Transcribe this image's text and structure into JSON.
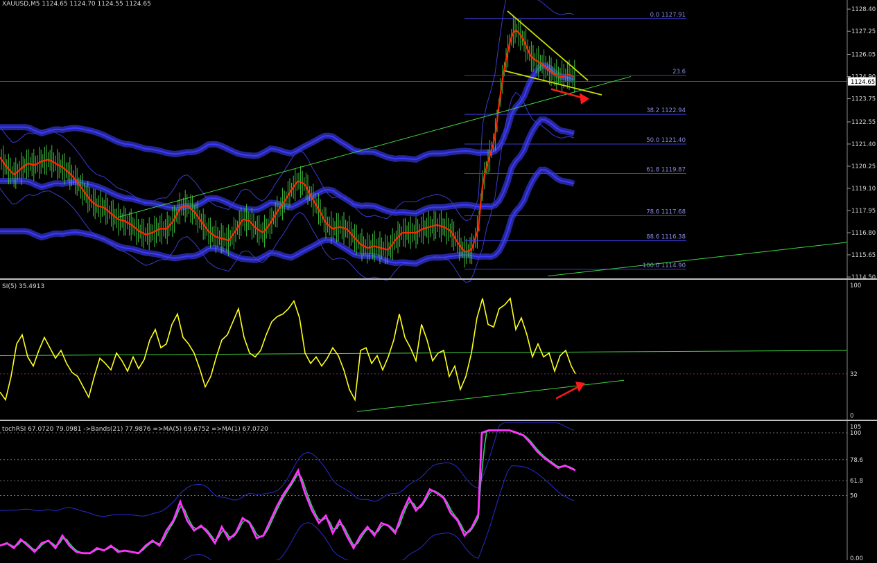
{
  "colors": {
    "background": "#000000",
    "axis_text": "#d8d8d8",
    "separator": "#c0c0c0",
    "bull_bar": "#3fbf3f",
    "price_ma": "#ff2a00",
    "bollinger": "#2a2aa8",
    "bollinger_thin": "#3a3ad0",
    "fib": "#3a3ad8",
    "fib_text": "#8a8ae6",
    "trendline": "#3fd43f",
    "wedge": "#c8e000",
    "rsi": "#ffff1a",
    "stoch": "#ff33ff",
    "stoch_ma": "#22d066",
    "level_dots": "#707070",
    "arrow": "#ff1a1a"
  },
  "chart_data": [
    {
      "type": "candlestick-bars",
      "title": "XAUUSD,M5 1124.65 1124.70 1124.55 1124.65",
      "symbol": "XAUUSD,M5",
      "ohlc_header": [
        "1124.65",
        "1124.70",
        "1124.55",
        "1124.65"
      ],
      "current_price": "1124.65",
      "ylim": [
        1114.5,
        1128.8
      ],
      "y_ticks": [
        "1128.40",
        "1127.25",
        "1126.05",
        "1124.90",
        "1123.75",
        "1122.55",
        "1121.40",
        "1120.25",
        "1119.10",
        "1117.95",
        "1116.80",
        "1115.65",
        "1114.50"
      ],
      "price_path": [
        [
          0,
          1120.7
        ],
        [
          10,
          1120.2
        ],
        [
          20,
          1119.8
        ],
        [
          30,
          1120.1
        ],
        [
          40,
          1120.4
        ],
        [
          50,
          1120.3
        ],
        [
          60,
          1120.5
        ],
        [
          70,
          1120.6
        ],
        [
          80,
          1120.4
        ],
        [
          90,
          1120.2
        ],
        [
          100,
          1119.9
        ],
        [
          110,
          1119.5
        ],
        [
          120,
          1119.0
        ],
        [
          130,
          1118.5
        ],
        [
          140,
          1118.2
        ],
        [
          150,
          1118.1
        ],
        [
          160,
          1117.8
        ],
        [
          170,
          1117.5
        ],
        [
          180,
          1117.4
        ],
        [
          190,
          1117.2
        ],
        [
          200,
          1116.9
        ],
        [
          210,
          1116.7
        ],
        [
          220,
          1116.8
        ],
        [
          230,
          1117.0
        ],
        [
          240,
          1117.0
        ],
        [
          250,
          1117.4
        ],
        [
          260,
          1118.1
        ],
        [
          270,
          1118.2
        ],
        [
          280,
          1117.9
        ],
        [
          290,
          1117.4
        ],
        [
          300,
          1116.9
        ],
        [
          310,
          1116.6
        ],
        [
          320,
          1116.5
        ],
        [
          330,
          1116.4
        ],
        [
          340,
          1116.9
        ],
        [
          350,
          1117.5
        ],
        [
          360,
          1117.4
        ],
        [
          370,
          1117.0
        ],
        [
          380,
          1116.8
        ],
        [
          390,
          1117.3
        ],
        [
          400,
          1117.9
        ],
        [
          410,
          1118.4
        ],
        [
          420,
          1119.0
        ],
        [
          430,
          1119.5
        ],
        [
          440,
          1119.3
        ],
        [
          450,
          1118.6
        ],
        [
          460,
          1118.0
        ],
        [
          470,
          1117.3
        ],
        [
          480,
          1117.0
        ],
        [
          490,
          1117.1
        ],
        [
          500,
          1117.0
        ],
        [
          510,
          1116.6
        ],
        [
          520,
          1116.2
        ],
        [
          530,
          1116.0
        ],
        [
          540,
          1116.1
        ],
        [
          550,
          1116.0
        ],
        [
          560,
          1115.9
        ],
        [
          570,
          1116.4
        ],
        [
          580,
          1116.8
        ],
        [
          590,
          1116.8
        ],
        [
          600,
          1116.8
        ],
        [
          610,
          1117.0
        ],
        [
          620,
          1117.1
        ],
        [
          630,
          1117.2
        ],
        [
          640,
          1117.1
        ],
        [
          650,
          1116.9
        ],
        [
          660,
          1116.3
        ],
        [
          670,
          1115.8
        ],
        [
          680,
          1115.9
        ],
        [
          690,
          1117.0
        ],
        [
          695,
          1119.0
        ],
        [
          700,
          1120.0
        ],
        [
          710,
          1121.2
        ],
        [
          715,
          1122.0
        ],
        [
          720,
          1123.5
        ],
        [
          725,
          1124.8
        ],
        [
          730,
          1125.8
        ],
        [
          735,
          1126.6
        ],
        [
          740,
          1127.2
        ],
        [
          745,
          1127.3
        ],
        [
          750,
          1127.1
        ],
        [
          755,
          1126.8
        ],
        [
          760,
          1126.4
        ],
        [
          765,
          1126.0
        ],
        [
          770,
          1125.8
        ],
        [
          780,
          1125.6
        ],
        [
          790,
          1125.3
        ],
        [
          800,
          1125.0
        ],
        [
          810,
          1124.9
        ],
        [
          820,
          1125.0
        ],
        [
          830,
          1124.9
        ]
      ],
      "fib_levels": [
        {
          "label": "0.0 1127.91",
          "price": 1127.91
        },
        {
          "label": "23.6",
          "price": 1124.95
        },
        {
          "label": "38.2 1122.94",
          "price": 1122.94
        },
        {
          "label": "50.0 1121.40",
          "price": 1121.4
        },
        {
          "label": "61.8 1119.87",
          "price": 1119.87
        },
        {
          "label": "78.6 1117.68",
          "price": 1117.68
        },
        {
          "label": "88.6 1116.38",
          "price": 1116.38
        },
        {
          "label": "100.0 1114.90",
          "price": 1114.9
        }
      ]
    },
    {
      "type": "line",
      "title": "SI(5) 35.4913",
      "ylim": [
        0,
        100
      ],
      "y_ticks": [
        "100",
        "32",
        "0"
      ],
      "level": 32,
      "values": [
        [
          0,
          18
        ],
        [
          8,
          12
        ],
        [
          16,
          30
        ],
        [
          24,
          55
        ],
        [
          32,
          62
        ],
        [
          40,
          45
        ],
        [
          48,
          38
        ],
        [
          56,
          50
        ],
        [
          64,
          60
        ],
        [
          72,
          52
        ],
        [
          80,
          44
        ],
        [
          88,
          50
        ],
        [
          96,
          40
        ],
        [
          104,
          33
        ],
        [
          112,
          30
        ],
        [
          120,
          22
        ],
        [
          128,
          14
        ],
        [
          136,
          30
        ],
        [
          144,
          44
        ],
        [
          152,
          40
        ],
        [
          160,
          35
        ],
        [
          168,
          48
        ],
        [
          176,
          42
        ],
        [
          184,
          34
        ],
        [
          192,
          45
        ],
        [
          200,
          36
        ],
        [
          208,
          43
        ],
        [
          216,
          58
        ],
        [
          224,
          66
        ],
        [
          232,
          52
        ],
        [
          240,
          55
        ],
        [
          248,
          70
        ],
        [
          256,
          78
        ],
        [
          264,
          60
        ],
        [
          272,
          55
        ],
        [
          280,
          48
        ],
        [
          288,
          36
        ],
        [
          296,
          22
        ],
        [
          304,
          30
        ],
        [
          312,
          45
        ],
        [
          320,
          58
        ],
        [
          328,
          62
        ],
        [
          336,
          72
        ],
        [
          344,
          82
        ],
        [
          352,
          60
        ],
        [
          360,
          48
        ],
        [
          368,
          45
        ],
        [
          376,
          50
        ],
        [
          384,
          62
        ],
        [
          392,
          72
        ],
        [
          400,
          76
        ],
        [
          408,
          78
        ],
        [
          416,
          82
        ],
        [
          424,
          88
        ],
        [
          432,
          75
        ],
        [
          440,
          48
        ],
        [
          448,
          40
        ],
        [
          456,
          45
        ],
        [
          464,
          38
        ],
        [
          472,
          44
        ],
        [
          480,
          52
        ],
        [
          488,
          46
        ],
        [
          496,
          35
        ],
        [
          504,
          20
        ],
        [
          512,
          12
        ],
        [
          520,
          50
        ],
        [
          528,
          52
        ],
        [
          536,
          40
        ],
        [
          544,
          46
        ],
        [
          552,
          35
        ],
        [
          560,
          45
        ],
        [
          568,
          58
        ],
        [
          576,
          78
        ],
        [
          584,
          60
        ],
        [
          592,
          52
        ],
        [
          600,
          42
        ],
        [
          608,
          70
        ],
        [
          616,
          58
        ],
        [
          624,
          42
        ],
        [
          632,
          48
        ],
        [
          640,
          50
        ],
        [
          648,
          30
        ],
        [
          656,
          38
        ],
        [
          664,
          20
        ],
        [
          672,
          30
        ],
        [
          680,
          48
        ],
        [
          688,
          75
        ],
        [
          696,
          90
        ],
        [
          704,
          70
        ],
        [
          712,
          68
        ],
        [
          720,
          82
        ],
        [
          728,
          85
        ],
        [
          736,
          90
        ],
        [
          744,
          66
        ],
        [
          752,
          75
        ],
        [
          760,
          62
        ],
        [
          768,
          45
        ],
        [
          776,
          55
        ],
        [
          784,
          45
        ],
        [
          792,
          48
        ],
        [
          800,
          34
        ],
        [
          808,
          46
        ],
        [
          816,
          50
        ],
        [
          824,
          38
        ],
        [
          830,
          32
        ]
      ]
    },
    {
      "type": "line",
      "title": "tochRSI 67.0720 79.0981 ->Bands(21) 77.9876 =>MA(5) 69.6752 =>MA(1) 67.0720",
      "ylim": [
        0,
        105
      ],
      "y_ticks": [
        "105",
        "100",
        "78.6",
        "61.8",
        "50",
        "0.00"
      ],
      "levels": [
        100,
        78.6,
        61.8,
        50
      ],
      "values": [
        [
          0,
          10
        ],
        [
          10,
          12
        ],
        [
          20,
          8
        ],
        [
          30,
          15
        ],
        [
          40,
          10
        ],
        [
          50,
          5
        ],
        [
          60,
          12
        ],
        [
          70,
          14
        ],
        [
          80,
          8
        ],
        [
          90,
          18
        ],
        [
          100,
          10
        ],
        [
          110,
          5
        ],
        [
          120,
          4
        ],
        [
          130,
          4
        ],
        [
          140,
          8
        ],
        [
          150,
          6
        ],
        [
          160,
          10
        ],
        [
          170,
          5
        ],
        [
          180,
          6
        ],
        [
          190,
          5
        ],
        [
          200,
          4
        ],
        [
          210,
          10
        ],
        [
          220,
          14
        ],
        [
          230,
          10
        ],
        [
          240,
          22
        ],
        [
          250,
          30
        ],
        [
          260,
          45
        ],
        [
          270,
          30
        ],
        [
          280,
          22
        ],
        [
          290,
          26
        ],
        [
          300,
          20
        ],
        [
          310,
          12
        ],
        [
          320,
          25
        ],
        [
          330,
          15
        ],
        [
          340,
          20
        ],
        [
          350,
          32
        ],
        [
          360,
          28
        ],
        [
          370,
          16
        ],
        [
          380,
          18
        ],
        [
          390,
          30
        ],
        [
          400,
          42
        ],
        [
          410,
          52
        ],
        [
          420,
          60
        ],
        [
          430,
          70
        ],
        [
          440,
          52
        ],
        [
          450,
          38
        ],
        [
          460,
          28
        ],
        [
          470,
          34
        ],
        [
          480,
          20
        ],
        [
          490,
          30
        ],
        [
          500,
          18
        ],
        [
          510,
          8
        ],
        [
          520,
          18
        ],
        [
          530,
          25
        ],
        [
          540,
          18
        ],
        [
          550,
          28
        ],
        [
          560,
          26
        ],
        [
          570,
          20
        ],
        [
          580,
          36
        ],
        [
          590,
          48
        ],
        [
          600,
          38
        ],
        [
          610,
          44
        ],
        [
          620,
          55
        ],
        [
          630,
          52
        ],
        [
          640,
          48
        ],
        [
          650,
          36
        ],
        [
          660,
          30
        ],
        [
          670,
          18
        ],
        [
          680,
          24
        ],
        [
          690,
          35
        ],
        [
          695,
          100
        ],
        [
          705,
          102
        ],
        [
          715,
          102
        ],
        [
          725,
          102
        ],
        [
          735,
          102
        ],
        [
          745,
          100
        ],
        [
          755,
          98
        ],
        [
          765,
          92
        ],
        [
          775,
          85
        ],
        [
          785,
          80
        ],
        [
          795,
          76
        ],
        [
          805,
          72
        ],
        [
          815,
          74
        ],
        [
          830,
          70
        ]
      ]
    }
  ]
}
